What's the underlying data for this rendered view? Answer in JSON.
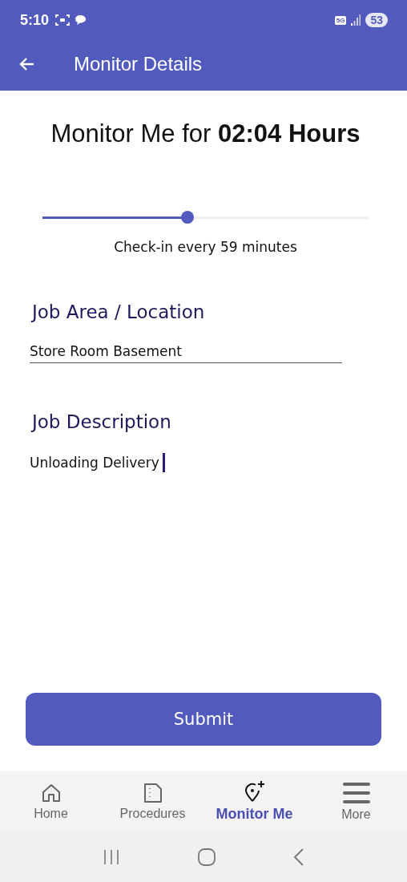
{
  "status_bar": {
    "time": "5:10",
    "network": "5G",
    "battery": "53"
  },
  "app_bar": {
    "title": "Monitor Details"
  },
  "heading": "Monitor Me for **02:04 Hours**",
  "slider": {
    "level": 0.445
  },
  "checkin": "Check-in every 59 minutes",
  "fields": [
    {
      "label": "Job Area / Location",
      "value": "Store Room Basement",
      "focused": false,
      "underline": true
    },
    {
      "label": "Job Description",
      "value": "Unloading Delivery",
      "focused": true,
      "underline": false
    }
  ],
  "submit": "Submit",
  "nav": [
    {
      "kind": "home",
      "label": "Home",
      "selected": false
    },
    {
      "kind": "document",
      "label": "Procedures",
      "selected": false
    },
    {
      "kind": "pin-add",
      "label": "Monitor Me",
      "selected": true
    },
    {
      "kind": "menu",
      "label": "More",
      "selected": false
    }
  ]
}
